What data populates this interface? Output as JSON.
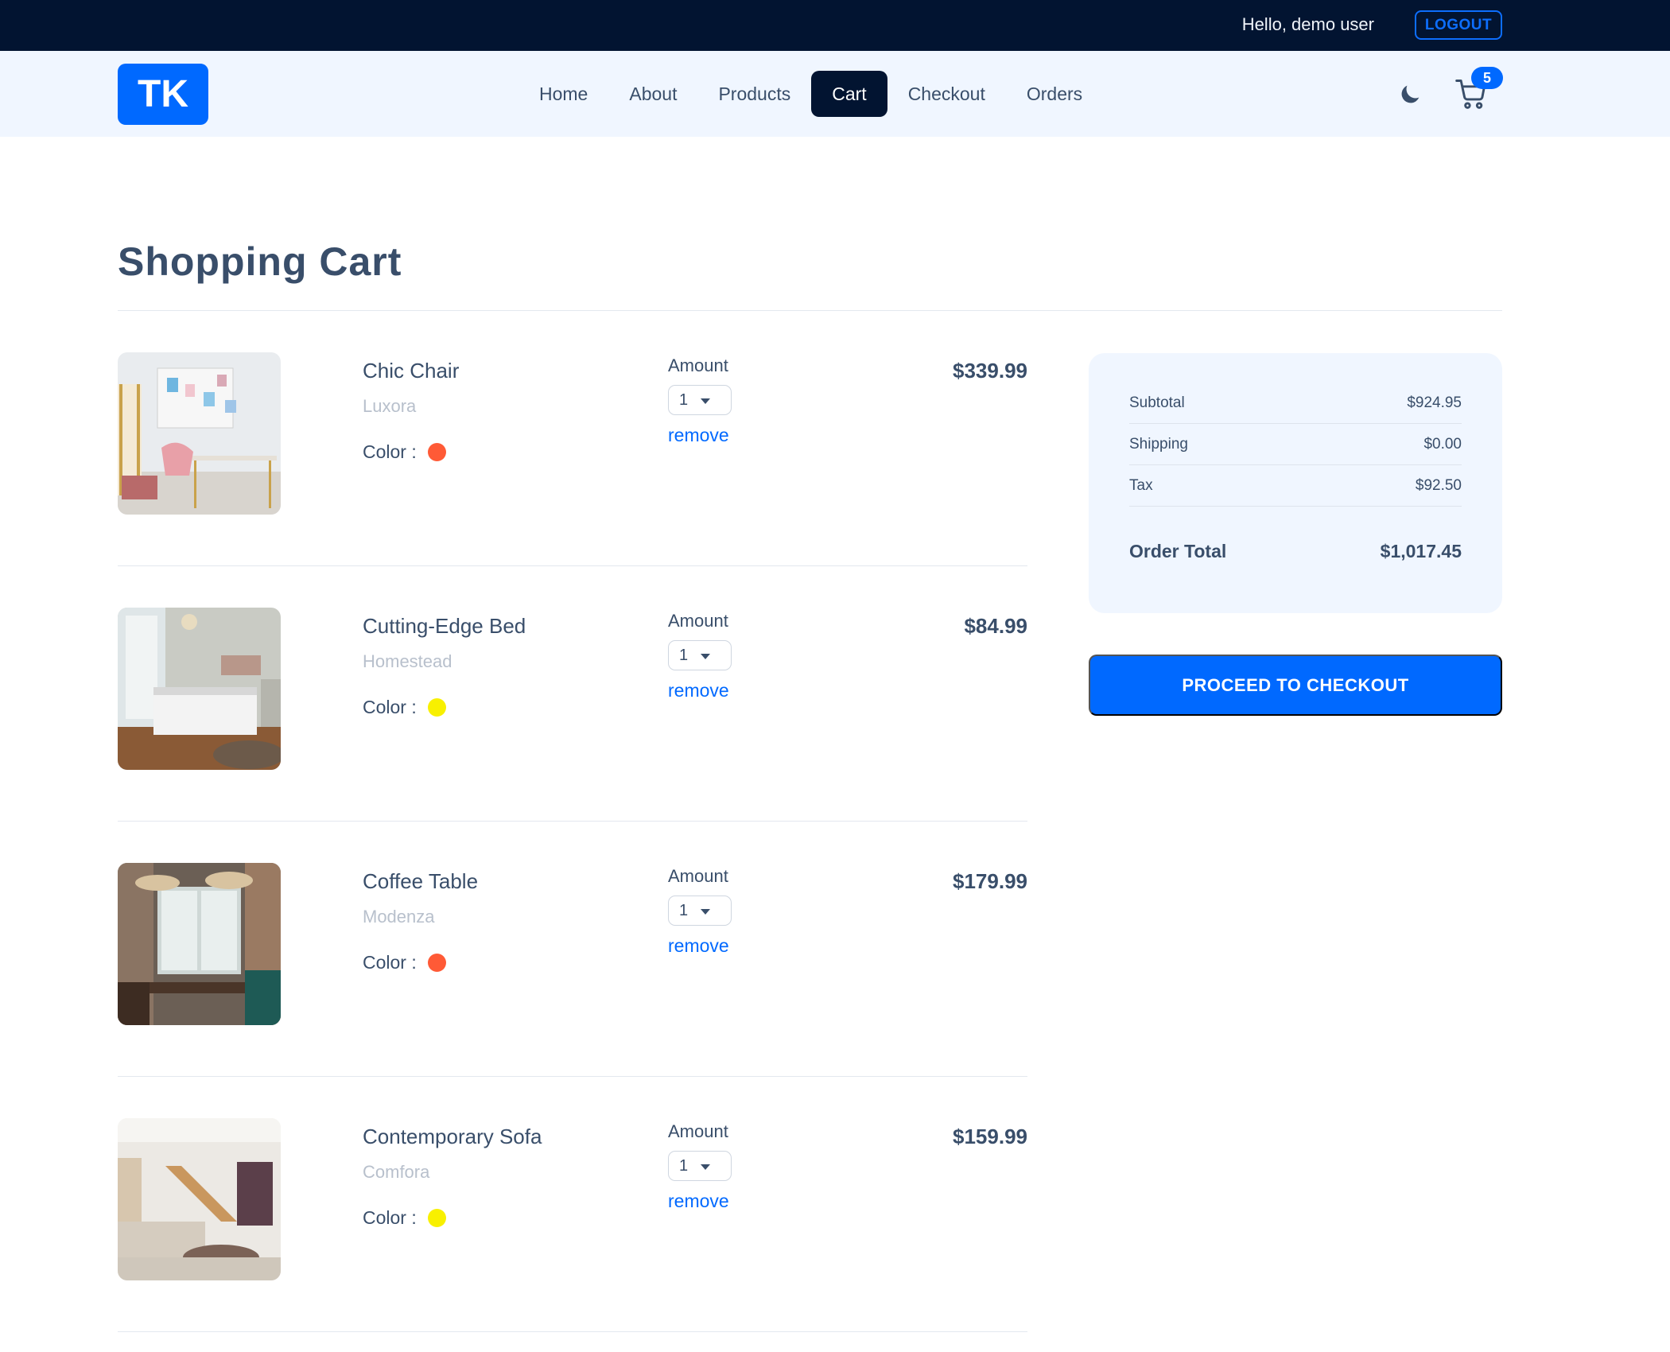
{
  "topbar": {
    "greeting": "Hello, demo user",
    "logout_label": "LOGOUT"
  },
  "navbar": {
    "logo_text": "TK",
    "links": [
      {
        "label": "Home",
        "active": false
      },
      {
        "label": "About",
        "active": false
      },
      {
        "label": "Products",
        "active": false
      },
      {
        "label": "Cart",
        "active": true
      },
      {
        "label": "Checkout",
        "active": false
      },
      {
        "label": "Orders",
        "active": false
      }
    ],
    "theme_icon": "moon-icon",
    "cart_icon": "cart-icon",
    "cart_count": "5"
  },
  "page": {
    "title": "Shopping Cart"
  },
  "cart_items": [
    {
      "name": "Chic Chair",
      "brand": "Luxora",
      "color_label": "Color :",
      "color": "#ff5a36",
      "amount_label": "Amount",
      "quantity": "1",
      "remove_label": "remove",
      "price": "$339.99",
      "image": "room-photo-study"
    },
    {
      "name": "Cutting-Edge Bed",
      "brand": "Homestead",
      "color_label": "Color :",
      "color": "#f8f000",
      "amount_label": "Amount",
      "quantity": "1",
      "remove_label": "remove",
      "price": "$84.99",
      "image": "room-photo-bedroom"
    },
    {
      "name": "Coffee Table",
      "brand": "Modenza",
      "color_label": "Color :",
      "color": "#ff5a36",
      "amount_label": "Amount",
      "quantity": "1",
      "remove_label": "remove",
      "price": "$179.99",
      "image": "room-photo-dining"
    },
    {
      "name": "Contemporary Sofa",
      "brand": "Comfora",
      "color_label": "Color :",
      "color": "#f8f000",
      "amount_label": "Amount",
      "quantity": "1",
      "remove_label": "remove",
      "price": "$159.99",
      "image": "room-photo-living"
    }
  ],
  "totals": {
    "subtotal_label": "Subtotal",
    "subtotal": "$924.95",
    "shipping_label": "Shipping",
    "shipping": "$0.00",
    "tax_label": "Tax",
    "tax": "$92.50",
    "order_total_label": "Order Total",
    "order_total": "$1,017.45"
  },
  "checkout_button": "PROCEED TO CHECKOUT",
  "colors": {
    "topbar_bg": "#021431",
    "navbar_bg": "#f0f6ff",
    "accent": "#0069ff",
    "text": "#394e6a",
    "muted": "#b8c0cc"
  }
}
